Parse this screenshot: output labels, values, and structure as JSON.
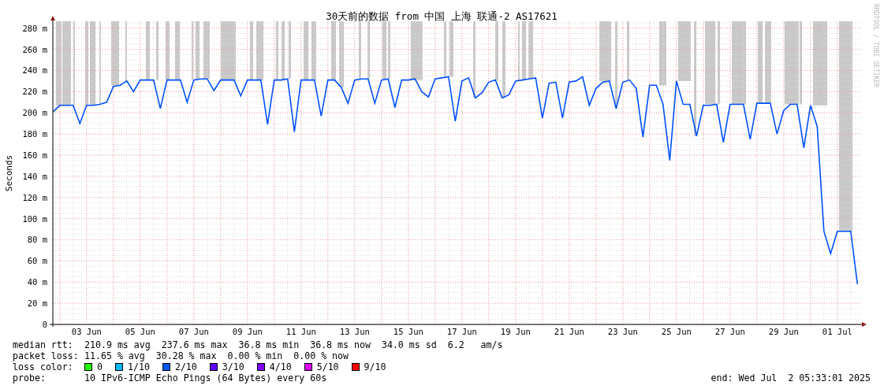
{
  "chart": {
    "credit": "RRDTOOL / TOBI OETIKER",
    "chart_data": {
      "type": "line",
      "title": "30天前的数据 from 中国 上海 联通-2 AS17621",
      "ylabel": "Seconds",
      "ylim": [
        0,
        285
      ],
      "grid": true,
      "categories": [
        null,
        null,
        null,
        null,
        null,
        "03 Jun",
        null,
        null,
        null,
        null,
        null,
        null,
        null,
        "05 Jun",
        null,
        null,
        null,
        null,
        null,
        null,
        null,
        "07 Jun",
        null,
        null,
        null,
        null,
        null,
        null,
        null,
        "09 Jun",
        null,
        null,
        null,
        null,
        null,
        null,
        null,
        "11 Jun",
        null,
        null,
        null,
        null,
        null,
        null,
        null,
        "13 Jun",
        null,
        null,
        null,
        null,
        null,
        null,
        null,
        "15 Jun",
        null,
        null,
        null,
        null,
        null,
        null,
        null,
        "17 Jun",
        null,
        null,
        null,
        null,
        null,
        null,
        null,
        "19 Jun",
        null,
        null,
        null,
        null,
        null,
        null,
        null,
        "21 Jun",
        null,
        null,
        null,
        null,
        null,
        null,
        null,
        "23 Jun",
        null,
        null,
        null,
        null,
        null,
        null,
        null,
        "25 Jun",
        null,
        null,
        null,
        null,
        null,
        null,
        null,
        "27 Jun",
        null,
        null,
        null,
        null,
        null,
        null,
        null,
        "29 Jun",
        null,
        null,
        null,
        null,
        null,
        null,
        null,
        "01 Jul",
        null,
        null,
        null
      ],
      "series": [
        {
          "color": "#0050ff",
          "values": [
            201,
            207,
            207,
            207,
            190,
            207,
            207,
            208,
            210,
            225,
            226,
            230,
            220,
            231,
            231,
            231,
            204,
            231,
            231,
            231,
            210,
            231,
            232,
            232,
            221,
            231,
            231,
            231,
            216,
            231,
            231,
            231,
            189,
            231,
            231,
            232,
            182,
            231,
            231,
            231,
            197,
            231,
            231,
            224,
            209,
            231,
            232,
            232,
            209,
            231,
            232,
            205,
            231,
            231,
            232,
            220,
            215,
            232,
            233,
            234,
            192,
            230,
            233,
            214,
            219,
            229,
            231,
            214,
            217,
            230,
            231,
            232,
            233,
            195,
            228,
            229,
            195,
            229,
            230,
            234,
            207,
            223,
            229,
            230,
            204,
            229,
            231,
            223,
            177,
            226,
            226,
            208,
            155,
            230,
            208,
            208,
            178,
            207,
            207,
            208,
            172,
            208,
            208,
            208,
            175,
            209,
            209,
            209,
            180,
            202,
            208,
            208,
            167,
            207,
            187,
            88,
            67,
            88,
            88,
            88,
            38
          ]
        }
      ],
      "yticks": [
        {
          "value": 0,
          "label": "0"
        },
        {
          "value": 20,
          "label": "20 m"
        },
        {
          "value": 40,
          "label": "40 m"
        },
        {
          "value": 60,
          "label": "60 m"
        },
        {
          "value": 80,
          "label": "80 m"
        },
        {
          "value": 100,
          "label": "100 m"
        },
        {
          "value": 120,
          "label": "120 m"
        },
        {
          "value": 140,
          "label": "140 m"
        },
        {
          "value": 160,
          "label": "160 m"
        },
        {
          "value": 180,
          "label": "180 m"
        },
        {
          "value": 200,
          "label": "200 m"
        },
        {
          "value": 220,
          "label": "220 m"
        },
        {
          "value": 240,
          "label": "240 m"
        },
        {
          "value": 260,
          "label": "260 m"
        },
        {
          "value": 280,
          "label": "280 m"
        }
      ]
    }
  },
  "stats": [
    {
      "label": "median rtt:",
      "text": "210.9 ms avg  237.6 ms max  36.8 ms min  36.8 ms now  34.0 ms sd  6.2   am/s"
    },
    {
      "label": "packet loss:",
      "text": "11.65 % avg  30.28 % max  0.00 % min  0.00 % now"
    }
  ],
  "loss_colors": {
    "label": "loss color:",
    "items": [
      {
        "label": "0",
        "color": "#26ff00"
      },
      {
        "label": "1/10",
        "color": "#00b8ff"
      },
      {
        "label": "2/10",
        "color": "#0059ff"
      },
      {
        "label": "3/10",
        "color": "#5e00ff"
      },
      {
        "label": "4/10",
        "color": "#7e00ff"
      },
      {
        "label": "5/10",
        "color": "#dd00ff"
      },
      {
        "label": "9/10",
        "color": "#ff0000"
      }
    ]
  },
  "probe": {
    "label": "probe:",
    "text": "10 IPv6-ICMP Echo Pings (64 Bytes) every 60s"
  },
  "end": "end: Wed Jul  2 05:33:01 2025"
}
